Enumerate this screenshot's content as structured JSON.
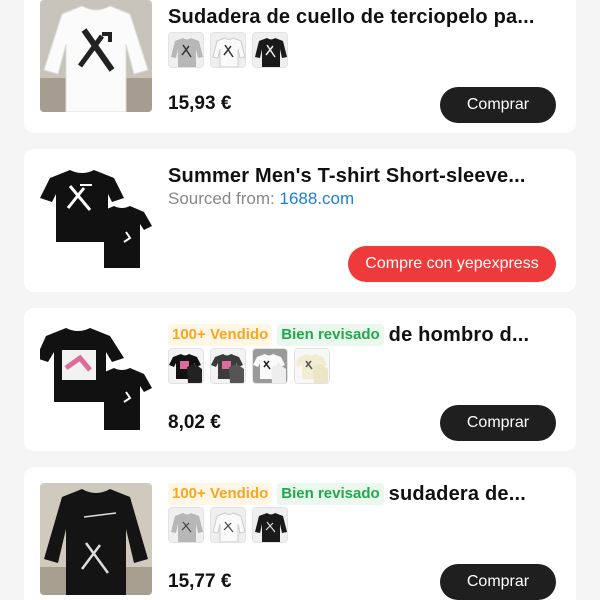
{
  "products": [
    {
      "title": "Sudadera de cuello de terciopelo pa...",
      "price": "15,93 €",
      "button_label": "Comprar",
      "variants": [
        "gray-sweatshirt",
        "white-sweatshirt",
        "black-sweatshirt"
      ]
    },
    {
      "title": "Summer Men's T-shirt Short-sleeve...",
      "sourced_label": "Sourced from:",
      "sourced_link": "1688.com",
      "button_label": "Compre con yepexpress"
    },
    {
      "badge_sold": "100+ Vendido",
      "badge_reviewed": "Bien revisado",
      "title": "de hombro d...",
      "price": "8,02 €",
      "button_label": "Comprar",
      "variants": [
        "black-tshirt-pink",
        "gray-tshirt",
        "white-tshirt",
        "cream-tshirt"
      ]
    },
    {
      "badge_sold": "100+ Vendido",
      "badge_reviewed": "Bien revisado",
      "title": "sudadera de...",
      "price": "15,77 €",
      "button_label": "Comprar",
      "variants": [
        "gray-sweatshirt",
        "white-sweatshirt",
        "black-sweatshirt"
      ]
    }
  ],
  "colors": {
    "buy_button": "#1f1f1f",
    "yep_button": "#ee3a3a",
    "link": "#1a7fd6",
    "badge_sold": "#f5a623",
    "badge_reviewed": "#22a84a"
  }
}
